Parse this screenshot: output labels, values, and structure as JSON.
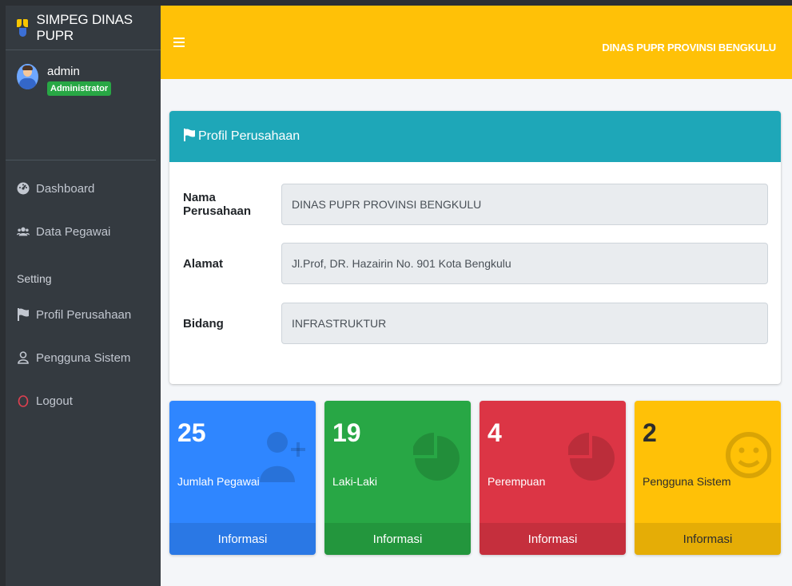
{
  "sidebar": {
    "brand": "SIMPEG DINAS PUPR",
    "user": {
      "name": "admin",
      "role": "Administrator"
    },
    "items": [
      {
        "label": "Dashboard",
        "icon": "dashboard-icon"
      },
      {
        "label": "Data Pegawai",
        "icon": "users-icon"
      }
    ],
    "setting_header": "Setting",
    "setting_items": [
      {
        "label": "Profil Perusahaan",
        "icon": "flag-icon"
      },
      {
        "label": "Pengguna Sistem",
        "icon": "user-icon"
      },
      {
        "label": "Logout",
        "icon": "power-icon"
      }
    ]
  },
  "header": {
    "title": "DINAS PUPR PROVINSI BENGKULU"
  },
  "profile_card": {
    "title": "Profil Perusahaan",
    "fields": [
      {
        "label": "Nama Perusahaan",
        "value": "DINAS PUPR PROVINSI BENGKULU"
      },
      {
        "label": "Alamat",
        "value": "Jl.Prof, DR. Hazairin No. 901 Kota Bengkulu"
      },
      {
        "label": "Bidang",
        "value": "INFRASTRUKTUR"
      }
    ]
  },
  "stats": [
    {
      "value": "25",
      "label": "Jumlah Pegawai",
      "footer": "Informasi",
      "color": "#2f86ff",
      "icon": "user-plus-icon"
    },
    {
      "value": "19",
      "label": "Laki-Laki",
      "footer": "Informasi",
      "color": "#28a745",
      "icon": "pie-chart-icon"
    },
    {
      "value": "4",
      "label": "Perempuan",
      "footer": "Informasi",
      "color": "#dc3545",
      "icon": "pie-chart-icon"
    },
    {
      "value": "2",
      "label": "Pengguna Sistem",
      "footer": "Informasi",
      "color": "#ffc107",
      "icon": "smile-icon"
    }
  ],
  "colors": {
    "sidebar": "#343a40",
    "header": "#ffc107",
    "card_header": "#1ea7b8"
  }
}
